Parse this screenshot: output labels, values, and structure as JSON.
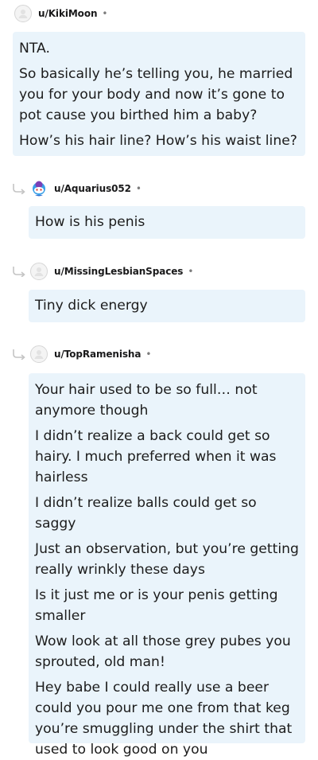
{
  "comments": [
    {
      "username": "u/KikiMoon",
      "separator": "•",
      "paragraphs": [
        "NTA.",
        "So basically he’s telling you, he married you for your body and now it’s gone to pot cause you birthed him a baby?",
        "How’s his hair line? How’s his waist line?"
      ]
    },
    {
      "username": "u/Aquarius052",
      "separator": "•",
      "paragraphs": [
        "How is his penis"
      ]
    },
    {
      "username": "u/MissingLesbianSpaces",
      "separator": "•",
      "paragraphs": [
        "Tiny dick energy"
      ]
    },
    {
      "username": "u/TopRamenisha",
      "separator": "•",
      "paragraphs": [
        "Your hair used to be so full… not anymore though",
        "I didn’t realize a back could get so hairy. I much preferred when it was hairless",
        "I didn’t realize balls could get so saggy",
        "Just an observation, but you’re getting really wrinkly these days",
        "Is it just me or is your penis getting smaller",
        "Wow look at all those grey pubes you sprouted, old man!",
        "Hey babe I could really use a beer could you pour me one from that keg you’re smuggling under the shirt that used to look good on you"
      ]
    }
  ]
}
